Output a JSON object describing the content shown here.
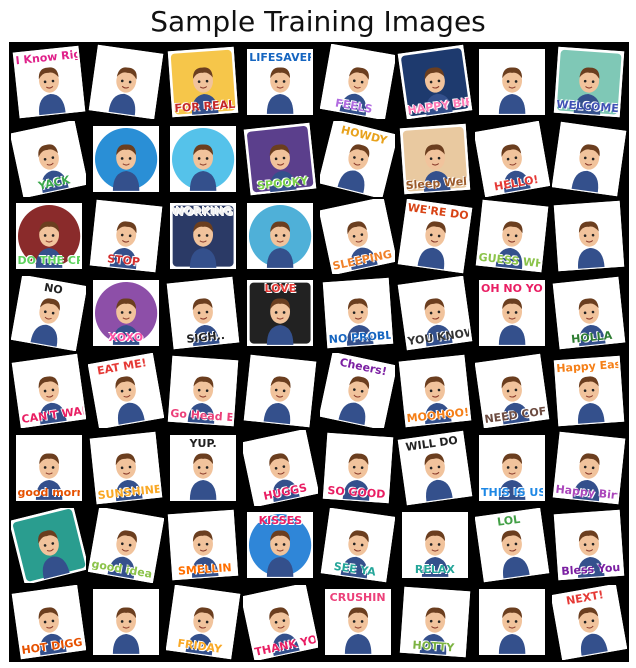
{
  "title": "Sample Training Images",
  "tiles": [
    {
      "bg": "#ffffff",
      "circle": false,
      "caption": "I Know Right?",
      "capColor": "#e0218a",
      "rot": -6
    },
    {
      "bg": "#ffffff",
      "circle": false,
      "caption": "",
      "capColor": "#333333",
      "rot": 8
    },
    {
      "bg": "#f6c64a",
      "circle": false,
      "caption": "FOR REAL",
      "capColor": "#c62828",
      "rot": -4
    },
    {
      "bg": "#ffffff",
      "circle": true,
      "caption": "LIFESAVER",
      "capColor": "#1565c0",
      "rot": 0
    },
    {
      "bg": "#ffffff",
      "circle": false,
      "caption": "FEELS",
      "capColor": "#b16be0",
      "rot": 10
    },
    {
      "bg": "#1e3a6e",
      "circle": false,
      "caption": "HAPPY BIRTHDAY",
      "capColor": "#ff7ab6",
      "rot": -8
    },
    {
      "bg": "#ffffff",
      "circle": false,
      "caption": "",
      "capColor": "#333333",
      "rot": 0
    },
    {
      "bg": "#7fc8b6",
      "circle": false,
      "caption": "WELCOME BACK",
      "capColor": "#3f51b5",
      "rot": 4
    },
    {
      "bg": "#ffffff",
      "circle": false,
      "caption": "YACK",
      "capColor": "#3aa84b",
      "rot": -12
    },
    {
      "bg": "#2a8fd6",
      "circle": true,
      "caption": "",
      "capColor": "#ffffff",
      "rot": 0
    },
    {
      "bg": "#55c2ea",
      "circle": true,
      "caption": "",
      "capColor": "#ffffff",
      "rot": 0
    },
    {
      "bg": "#5b3f8c",
      "circle": false,
      "caption": "SPOOKY",
      "capColor": "#7bd14a",
      "rot": -6
    },
    {
      "bg": "#ffffff",
      "circle": false,
      "caption": "HOWDY",
      "capColor": "#e8a21c",
      "rot": 14
    },
    {
      "bg": "#e9c9a0",
      "circle": false,
      "caption": "Sleep Well",
      "capColor": "#9c5b2b",
      "rot": -4
    },
    {
      "bg": "#ffffff",
      "circle": false,
      "caption": "HELLO!",
      "capColor": "#e53935",
      "rot": -10
    },
    {
      "bg": "#ffffff",
      "circle": false,
      "caption": "",
      "capColor": "#333333",
      "rot": 8
    },
    {
      "bg": "#8a2b2b",
      "circle": true,
      "caption": "DO THE CREEP",
      "capColor": "#5fd35f",
      "rot": 0
    },
    {
      "bg": "#ffffff",
      "circle": false,
      "caption": "STOP",
      "capColor": "#d32f2f",
      "rot": 6
    },
    {
      "bg": "#2b3a66",
      "circle": false,
      "caption": "WORKING LATE",
      "capColor": "#f0f0f0",
      "rot": 0
    },
    {
      "bg": "#4fb0d8",
      "circle": true,
      "caption": "",
      "capColor": "#ffffff",
      "rot": 0
    },
    {
      "bg": "#ffffff",
      "circle": false,
      "caption": "SLEEPING TIME",
      "capColor": "#f0812a",
      "rot": -12
    },
    {
      "bg": "#ffffff",
      "circle": false,
      "caption": "WE'RE DONE.",
      "capColor": "#d84315",
      "rot": 8
    },
    {
      "bg": "#ffffff",
      "circle": false,
      "caption": "GUESS WHO'S",
      "capColor": "#8bc34a",
      "rot": 6
    },
    {
      "bg": "#ffffff",
      "circle": false,
      "caption": "",
      "capColor": "#333333",
      "rot": -4
    },
    {
      "bg": "#ffffff",
      "circle": false,
      "caption": "NO",
      "capColor": "#222222",
      "rot": 10
    },
    {
      "bg": "#8d4fa8",
      "circle": true,
      "caption": "XOXO",
      "capColor": "#ff4fa3",
      "rot": 0
    },
    {
      "bg": "#ffffff",
      "circle": false,
      "caption": "SIGH..",
      "capColor": "#222222",
      "rot": -6
    },
    {
      "bg": "#222222",
      "circle": false,
      "caption": "LOVE",
      "capColor": "#e53935",
      "rot": 0
    },
    {
      "bg": "#ffffff",
      "circle": false,
      "caption": "NO PROBLEM",
      "capColor": "#1565c0",
      "rot": -4
    },
    {
      "bg": "#ffffff",
      "circle": false,
      "caption": "YOU KNOW NOTHING",
      "capColor": "#333333",
      "rot": -8
    },
    {
      "bg": "#ffffff",
      "circle": false,
      "caption": "OH NO YOU DI'NT",
      "capColor": "#e91e63",
      "rot": 0
    },
    {
      "bg": "#ffffff",
      "circle": false,
      "caption": "HOLLA",
      "capColor": "#2e7d32",
      "rot": -6
    },
    {
      "bg": "#ffffff",
      "circle": false,
      "caption": "CAN'T WAIT TO SEE YOU",
      "capColor": "#e91e63",
      "rot": -8
    },
    {
      "bg": "#ffffff",
      "circle": false,
      "caption": "EAT ME!",
      "capColor": "#e53935",
      "rot": -10
    },
    {
      "bg": "#ffffff",
      "circle": false,
      "caption": "Go Head Eat",
      "capColor": "#ec407a",
      "rot": 4
    },
    {
      "bg": "#ffffff",
      "circle": false,
      "caption": "",
      "capColor": "#333333",
      "rot": 6
    },
    {
      "bg": "#ffffff",
      "circle": false,
      "caption": "Cheers!",
      "capColor": "#7b1fa2",
      "rot": 12
    },
    {
      "bg": "#ffffff",
      "circle": false,
      "caption": "MOOHOO!",
      "capColor": "#f57f17",
      "rot": -6
    },
    {
      "bg": "#ffffff",
      "circle": false,
      "caption": "NEED COFFEE",
      "capColor": "#6d4c41",
      "rot": -8
    },
    {
      "bg": "#ffffff",
      "circle": false,
      "caption": "Happy Easter",
      "capColor": "#f57f17",
      "rot": -4
    },
    {
      "bg": "#ffffff",
      "circle": false,
      "caption": "good morning",
      "capColor": "#e65100",
      "rot": 0
    },
    {
      "bg": "#ffffff",
      "circle": false,
      "caption": "SUNSHINE",
      "capColor": "#f9a825",
      "rot": -6
    },
    {
      "bg": "#ffffff",
      "circle": false,
      "caption": "YUP.",
      "capColor": "#222222",
      "rot": 0
    },
    {
      "bg": "#ffffff",
      "circle": false,
      "caption": "HUGGS",
      "capColor": "#e91e63",
      "rot": -12
    },
    {
      "bg": "#ffffff",
      "circle": false,
      "caption": "SO GOOD",
      "capColor": "#e91e63",
      "rot": 4
    },
    {
      "bg": "#ffffff",
      "circle": false,
      "caption": "WILL DO",
      "capColor": "#222222",
      "rot": -8
    },
    {
      "bg": "#ffffff",
      "circle": false,
      "caption": "THIS IS US",
      "capColor": "#1e88e5",
      "rot": 0
    },
    {
      "bg": "#ffffff",
      "circle": false,
      "caption": "Happy Birthday",
      "capColor": "#ab47bc",
      "rot": 6
    },
    {
      "bg": "#2a9d8f",
      "circle": false,
      "caption": "",
      "capColor": "#ffffff",
      "rot": -14
    },
    {
      "bg": "#ffffff",
      "circle": false,
      "caption": "good idea",
      "capColor": "#8bc34a",
      "rot": 10
    },
    {
      "bg": "#ffffff",
      "circle": false,
      "caption": "SMELLIN",
      "capColor": "#ff6f00",
      "rot": -4
    },
    {
      "bg": "#2f86d8",
      "circle": true,
      "caption": "KISSES",
      "capColor": "#e91e63",
      "rot": 0
    },
    {
      "bg": "#ffffff",
      "circle": false,
      "caption": "SEE YA",
      "capColor": "#26a69a",
      "rot": 8
    },
    {
      "bg": "#ffffff",
      "circle": false,
      "caption": "RELAX",
      "capColor": "#26a69a",
      "rot": 0
    },
    {
      "bg": "#ffffff",
      "circle": false,
      "caption": "LOL",
      "capColor": "#43a047",
      "rot": -8
    },
    {
      "bg": "#ffffff",
      "circle": false,
      "caption": "Bless You",
      "capColor": "#7b1fa2",
      "rot": -4
    },
    {
      "bg": "#ffffff",
      "circle": false,
      "caption": "HOT DIGGITY",
      "capColor": "#e65100",
      "rot": -8
    },
    {
      "bg": "#ffffff",
      "circle": false,
      "caption": "",
      "capColor": "#333333",
      "rot": 0
    },
    {
      "bg": "#ffffff",
      "circle": false,
      "caption": "FRIDAY",
      "capColor": "#f9a825",
      "rot": 8
    },
    {
      "bg": "#ffffff",
      "circle": false,
      "caption": "THANK YOU",
      "capColor": "#e91e63",
      "rot": -12
    },
    {
      "bg": "#ffffff",
      "circle": false,
      "caption": "CRUSHIN",
      "capColor": "#ec407a",
      "rot": 0
    },
    {
      "bg": "#ffffff",
      "circle": false,
      "caption": "HOTTY",
      "capColor": "#7cb342",
      "rot": 4
    },
    {
      "bg": "#ffffff",
      "circle": false,
      "caption": "",
      "capColor": "#333333",
      "rot": 0
    },
    {
      "bg": "#ffffff",
      "circle": false,
      "caption": "NEXT!",
      "capColor": "#e53935",
      "rot": -10
    }
  ]
}
